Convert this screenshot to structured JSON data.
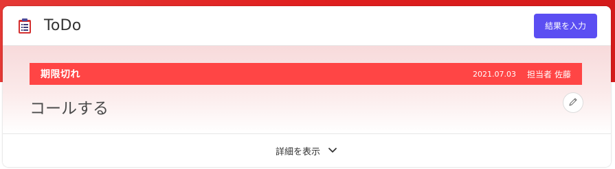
{
  "card": {
    "title": "ToDo",
    "result_button_label": "結果を入力",
    "status": {
      "label": "期限切れ",
      "date": "2021.07.03",
      "assignee_role": "担当者",
      "assignee_name": "佐藤",
      "color": "#ff4545"
    },
    "task_title": "コールする",
    "footer": {
      "toggle_label": "詳細を表示"
    },
    "accent_color": "#5b4ef2",
    "icons": {
      "title_icon": "clipboard-icon",
      "edit_icon": "pencil-icon",
      "toggle_icon": "chevron-down-icon"
    }
  }
}
